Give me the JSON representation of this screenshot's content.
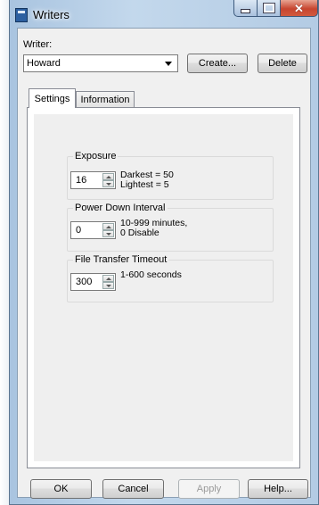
{
  "window": {
    "title": "Writers"
  },
  "writer": {
    "label": "Writer:",
    "selected": "Howard",
    "create_label": "Create...",
    "delete_label": "Delete"
  },
  "tabs": [
    {
      "label": "Settings"
    },
    {
      "label": "Information"
    }
  ],
  "settings": {
    "exposure": {
      "title": "Exposure",
      "value": "16",
      "hint1": "Darkest = 50",
      "hint2": "Lightest = 5"
    },
    "power_down": {
      "title": "Power Down Interval",
      "value": "0",
      "hint1": "10-999 minutes,",
      "hint2": "0 Disable"
    },
    "file_transfer": {
      "title": "File Transfer Timeout",
      "value": "300",
      "hint1": "1-600 seconds"
    }
  },
  "buttons": {
    "ok": "OK",
    "cancel": "Cancel",
    "apply": "Apply",
    "help": "Help..."
  }
}
